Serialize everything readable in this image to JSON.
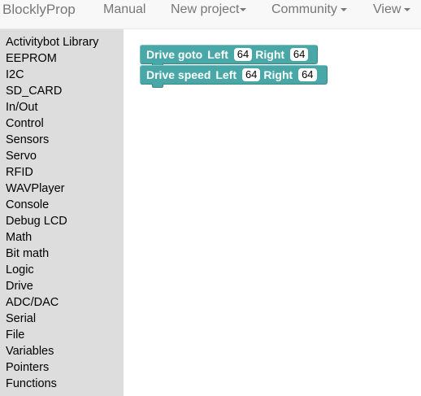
{
  "navbar": {
    "brand": "BlocklyProp",
    "items": [
      {
        "label": "Manual",
        "dropdown": false
      },
      {
        "label": "New project",
        "dropdown": true
      },
      {
        "label": "Community",
        "dropdown": true
      },
      {
        "label": "View",
        "dropdown": true
      }
    ]
  },
  "toolbox": {
    "categories": [
      "Activitybot Library",
      "EEPROM",
      "I2C",
      "SD_CARD",
      "In/Out",
      "Control",
      "Sensors",
      "Servo",
      "RFID",
      "WAVPlayer",
      "Console",
      "Debug LCD",
      "Math",
      "Bit math",
      "Logic",
      "Drive",
      "ADC/DAC",
      "Serial",
      "File",
      "Variables",
      "Pointers",
      "Functions"
    ]
  },
  "workspace": {
    "blocks": [
      {
        "title": "Drive goto",
        "left_label": "Left",
        "left_value": "64",
        "right_label": "Right",
        "right_value": "64"
      },
      {
        "title": "Drive speed",
        "left_label": "Left",
        "left_value": "64",
        "right_label": "Right",
        "right_value": "64"
      }
    ]
  },
  "colors": {
    "block": "#49a7a7",
    "toolbox_bg": "#dddddd",
    "navbar_bg": "#f8f8f8",
    "nav_text": "#777777"
  }
}
